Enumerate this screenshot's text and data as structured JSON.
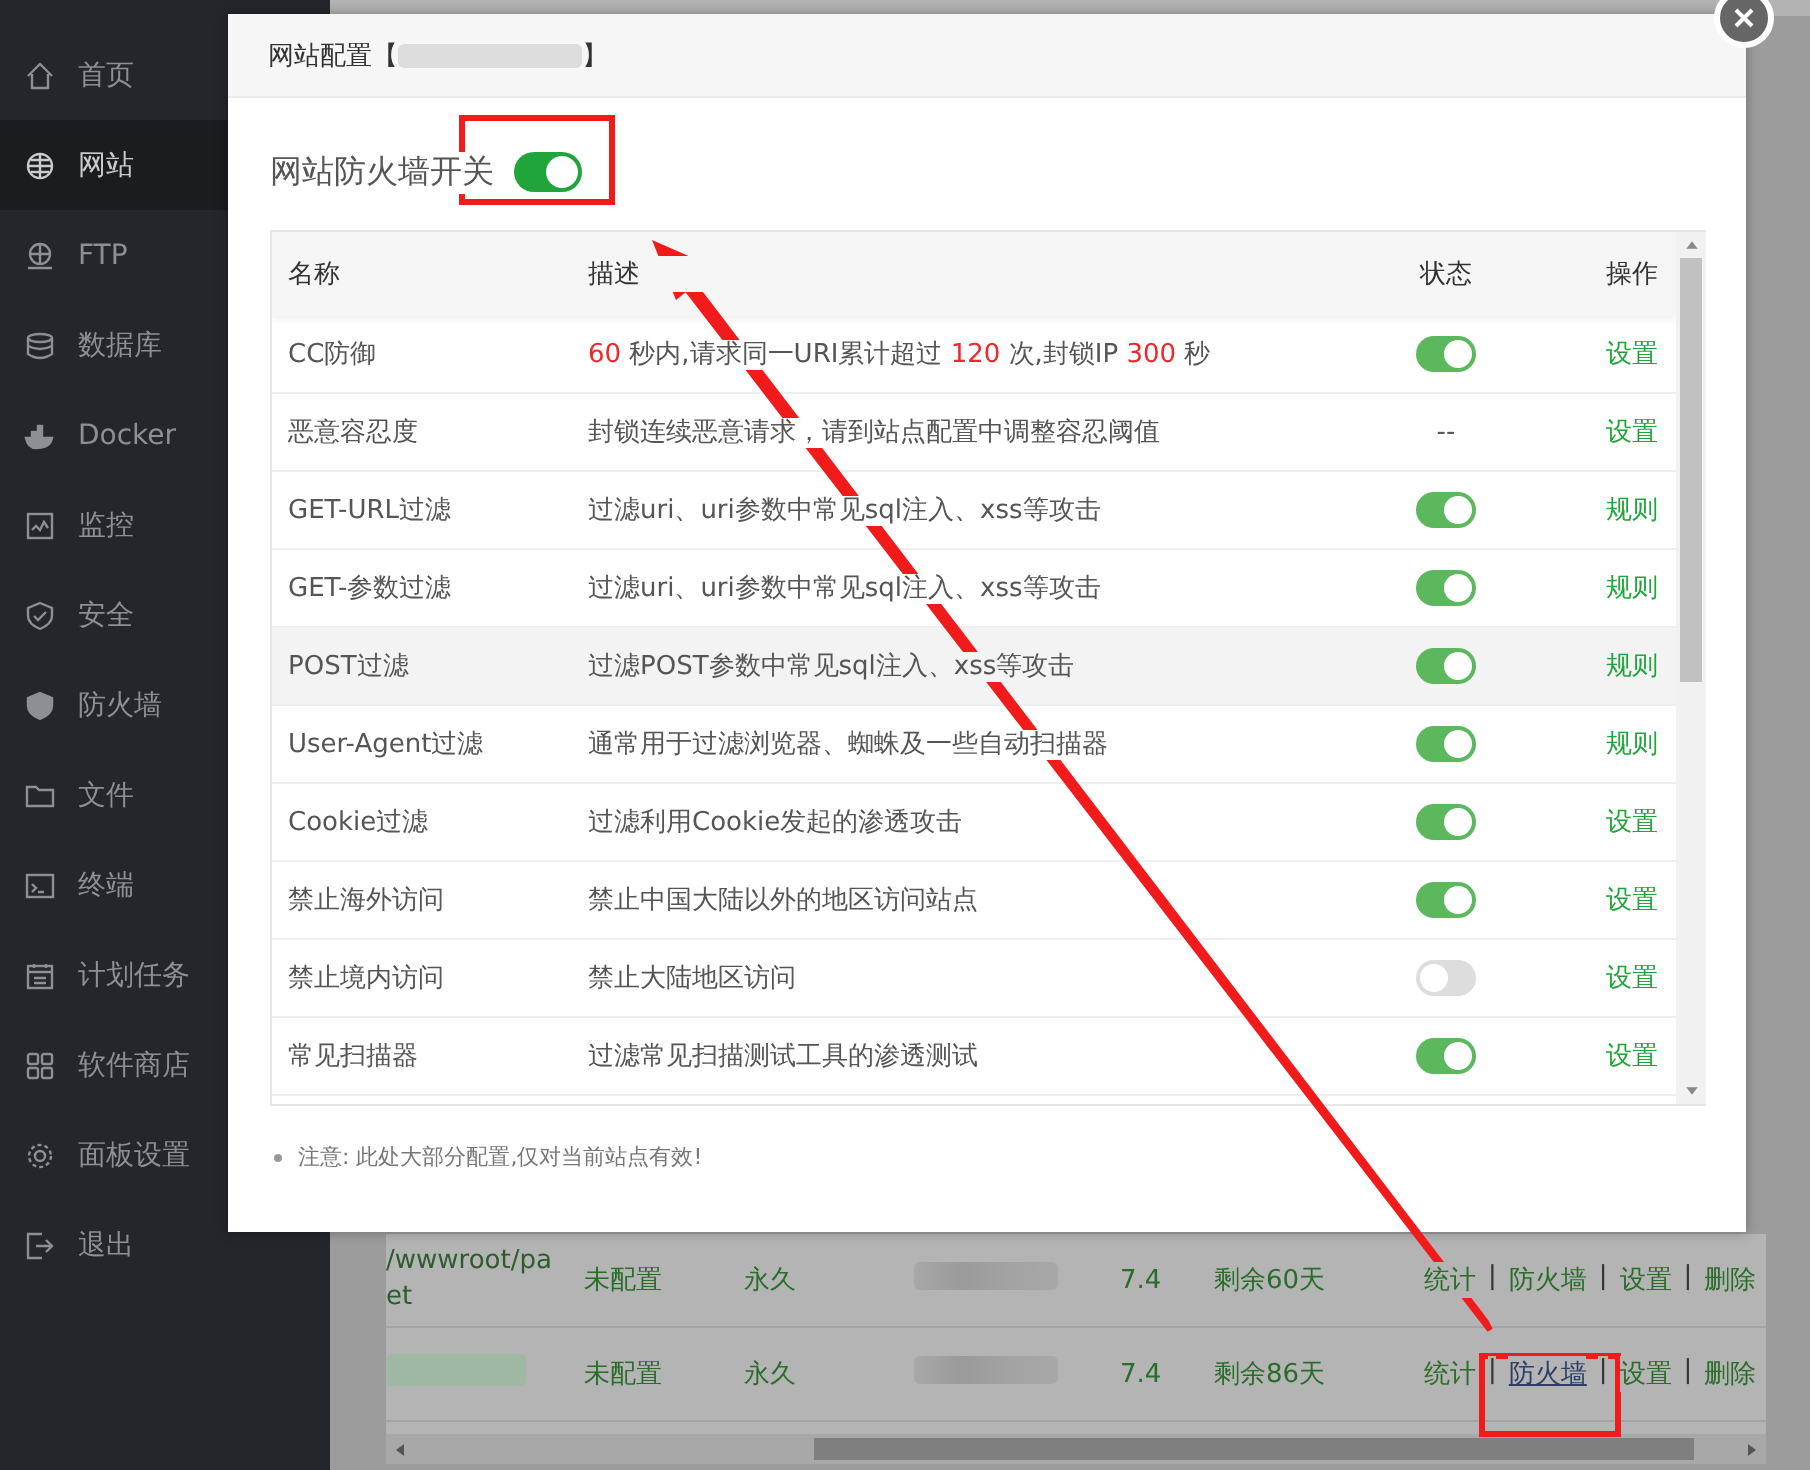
{
  "sidebar": {
    "items": [
      {
        "label": "首页",
        "selected": false
      },
      {
        "label": "网站",
        "selected": true
      },
      {
        "label": "FTP",
        "selected": false
      },
      {
        "label": "数据库",
        "selected": false
      },
      {
        "label": "Docker",
        "selected": false
      },
      {
        "label": "监控",
        "selected": false
      },
      {
        "label": "安全",
        "selected": false
      },
      {
        "label": "防火墙",
        "selected": false
      },
      {
        "label": "文件",
        "selected": false
      },
      {
        "label": "终端",
        "selected": false
      },
      {
        "label": "计划任务",
        "selected": false
      },
      {
        "label": "软件商店",
        "selected": false
      },
      {
        "label": "面板设置",
        "selected": false
      },
      {
        "label": "退出",
        "selected": false
      }
    ]
  },
  "sites_table": {
    "separator": "|",
    "rows": [
      {
        "cells": [
          {
            "kind": "path",
            "lines": [
              "/wwwroot/pa",
              "et"
            ]
          },
          {
            "kind": "text",
            "text": "未配置"
          },
          {
            "kind": "text",
            "text": "永久"
          },
          {
            "kind": "blurred"
          },
          {
            "kind": "text",
            "text": "7.4"
          },
          {
            "kind": "text",
            "text": "剩余60天"
          }
        ],
        "actions": [
          {
            "label": "统计",
            "underlined": false
          },
          {
            "label": "防火墙",
            "underlined": false
          },
          {
            "label": "设置",
            "underlined": false
          },
          {
            "label": "删除",
            "underlined": false
          }
        ]
      },
      {
        "cells": [
          {
            "kind": "blurred"
          },
          {
            "kind": "text",
            "text": "未配置"
          },
          {
            "kind": "text",
            "text": "永久"
          },
          {
            "kind": "blurred"
          },
          {
            "kind": "text",
            "text": "7.4"
          },
          {
            "kind": "text",
            "text": "剩余86天"
          }
        ],
        "actions": [
          {
            "label": "统计",
            "underlined": false
          },
          {
            "label": "防火墙",
            "underlined": true
          },
          {
            "label": "设置",
            "underlined": false
          },
          {
            "label": "删除",
            "underlined": false
          }
        ]
      }
    ]
  },
  "dialog": {
    "title_start": "网站配置【",
    "title_end": "】",
    "firewall_switch": {
      "label": "网站防火墙开关",
      "on": true
    },
    "table": {
      "columns": [
        "名称",
        "描述",
        "状态",
        "操作"
      ],
      "rows": [
        {
          "name": "CC防御",
          "description": [
            {
              "text": "60",
              "kind": "number"
            },
            {
              "text": " 秒内,请求同一URI累计超过 ",
              "kind": "text"
            },
            {
              "text": "120",
              "kind": "number"
            },
            {
              "text": " 次,封锁IP ",
              "kind": "text"
            },
            {
              "text": "300",
              "kind": "number"
            },
            {
              "text": " 秒",
              "kind": "text"
            }
          ],
          "status": {
            "kind": "switch",
            "on": true
          },
          "action": "设置",
          "selected": false
        },
        {
          "name": "恶意容忍度",
          "description": [
            {
              "text": "封锁连续恶意请求，请到站点配置中调整容忍阈值",
              "kind": "text"
            }
          ],
          "status": {
            "kind": "text",
            "text": "--"
          },
          "action": "设置",
          "selected": false
        },
        {
          "name": "GET-URL过滤",
          "description": [
            {
              "text": "过滤uri、uri参数中常见sql注入、xss等攻击",
              "kind": "text"
            }
          ],
          "status": {
            "kind": "switch",
            "on": true
          },
          "action": "规则",
          "selected": false
        },
        {
          "name": "GET-参数过滤",
          "description": [
            {
              "text": "过滤uri、uri参数中常见sql注入、xss等攻击",
              "kind": "text"
            }
          ],
          "status": {
            "kind": "switch",
            "on": true
          },
          "action": "规则",
          "selected": false
        },
        {
          "name": "POST过滤",
          "description": [
            {
              "text": "过滤POST参数中常见sql注入、xss等攻击",
              "kind": "text"
            }
          ],
          "status": {
            "kind": "switch",
            "on": true
          },
          "action": "规则",
          "selected": true
        },
        {
          "name": "User-Agent过滤",
          "description": [
            {
              "text": "通常用于过滤浏览器、蜘蛛及一些自动扫描器",
              "kind": "text"
            }
          ],
          "status": {
            "kind": "switch",
            "on": true
          },
          "action": "规则",
          "selected": false
        },
        {
          "name": "Cookie过滤",
          "description": [
            {
              "text": "过滤利用Cookie发起的渗透攻击",
              "kind": "text"
            }
          ],
          "status": {
            "kind": "switch",
            "on": true
          },
          "action": "设置",
          "selected": false
        },
        {
          "name": "禁止海外访问",
          "description": [
            {
              "text": "禁止中国大陆以外的地区访问站点",
              "kind": "text"
            }
          ],
          "status": {
            "kind": "switch",
            "on": true
          },
          "action": "设置",
          "selected": false
        },
        {
          "name": "禁止境内访问",
          "description": [
            {
              "text": "禁止大陆地区访问",
              "kind": "text"
            }
          ],
          "status": {
            "kind": "switch",
            "on": false
          },
          "action": "设置",
          "selected": false
        },
        {
          "name": "常见扫描器",
          "description": [
            {
              "text": "过滤常见扫描测试工具的渗透测试",
              "kind": "text"
            }
          ],
          "status": {
            "kind": "switch",
            "on": true
          },
          "action": "设置",
          "selected": false
        }
      ]
    },
    "note": "注意: 此处大部分配置,仅对当前站点有效!"
  }
}
